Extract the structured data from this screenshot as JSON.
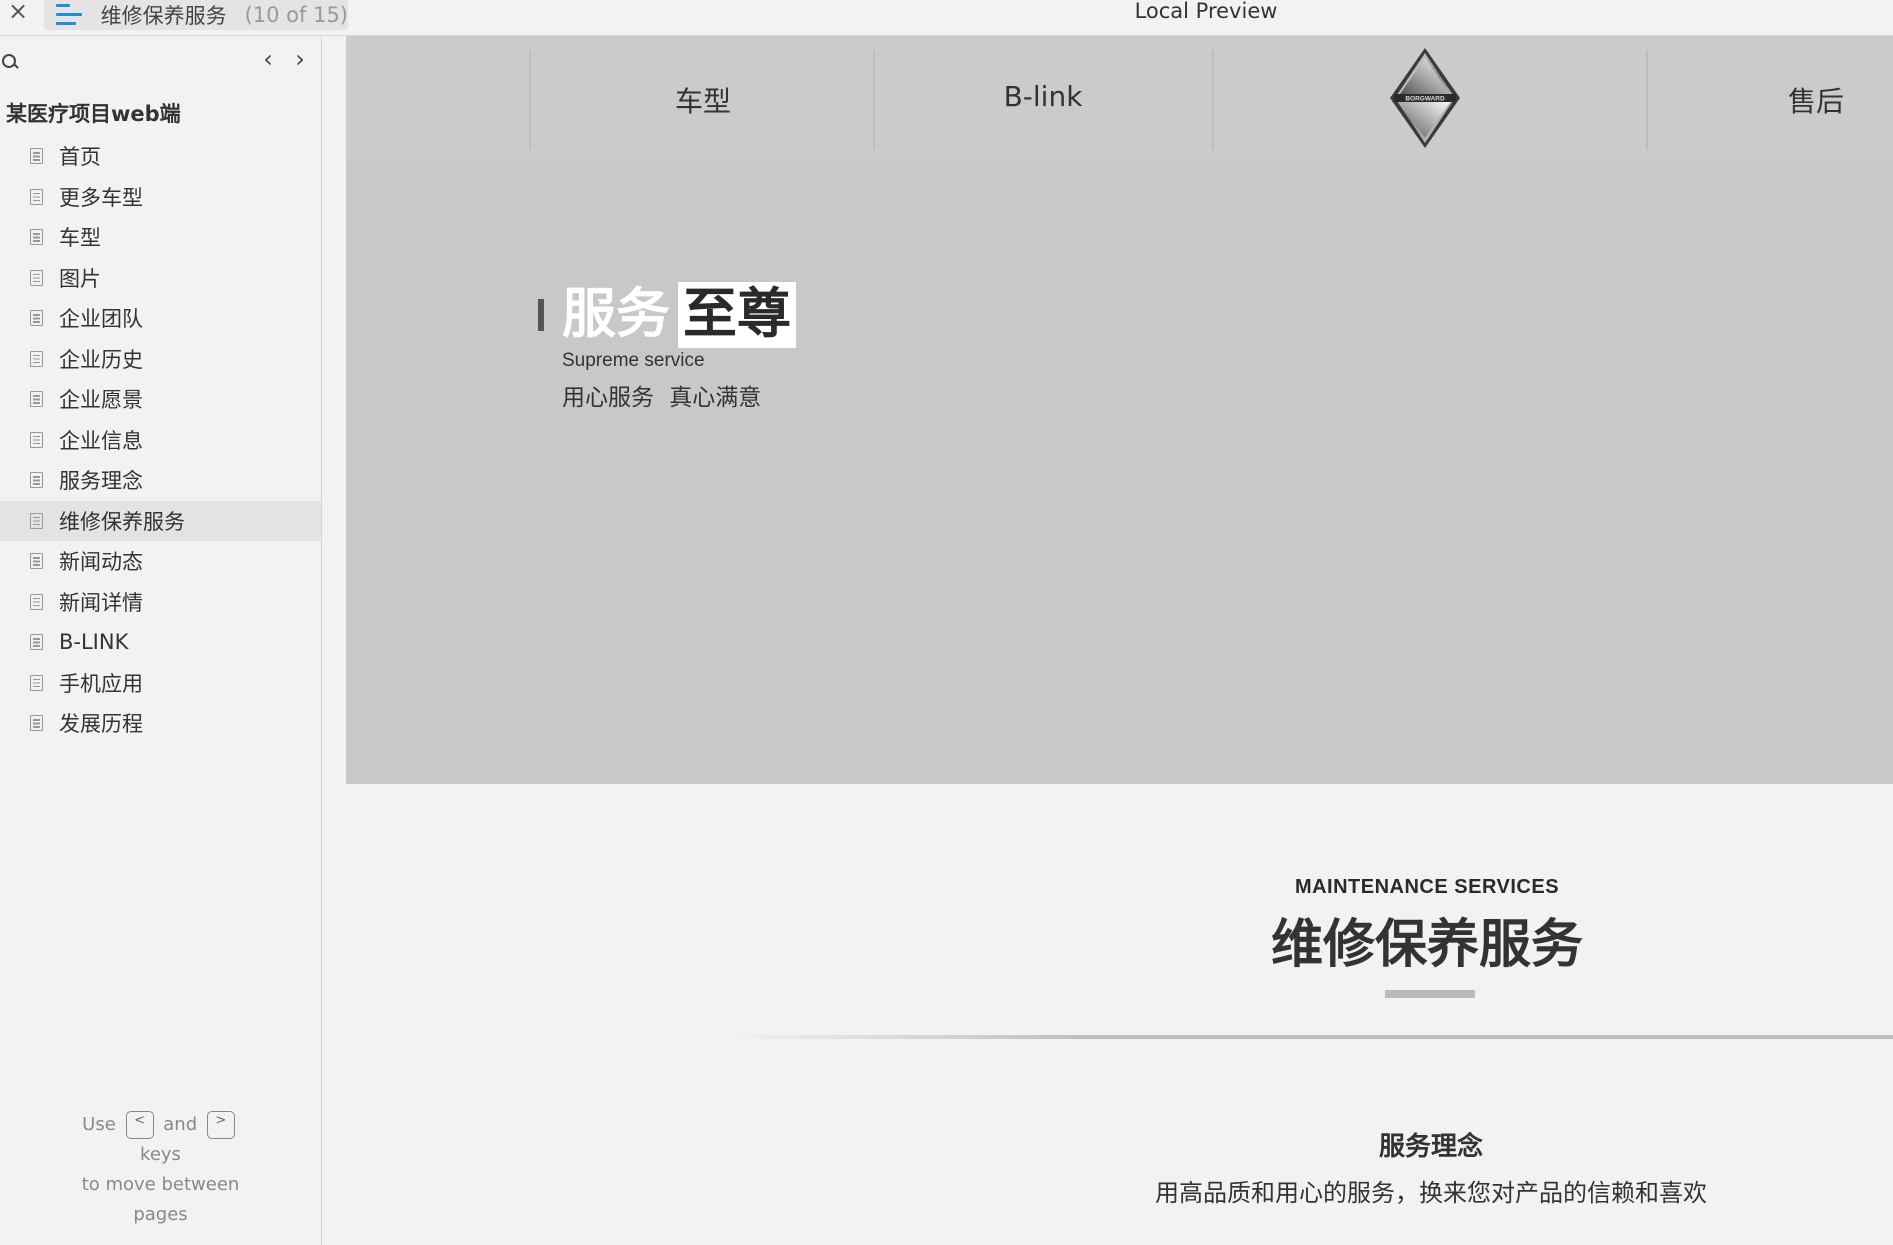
{
  "window": {
    "close_glyph": "×",
    "tab_title": "维修保养服务",
    "tab_count": "(10 of 15)",
    "title": "Local Preview"
  },
  "sidebar": {
    "project_name": "某医疗项目web端",
    "prev_glyph": "‹",
    "next_glyph": "›",
    "items": [
      {
        "label": "首页"
      },
      {
        "label": "更多车型"
      },
      {
        "label": "车型"
      },
      {
        "label": "图片"
      },
      {
        "label": "企业团队"
      },
      {
        "label": "企业历史"
      },
      {
        "label": "企业愿景"
      },
      {
        "label": "企业信息"
      },
      {
        "label": "服务理念"
      },
      {
        "label": "维修保养服务",
        "active": true
      },
      {
        "label": "新闻动态"
      },
      {
        "label": "新闻详情"
      },
      {
        "label": "B-LINK"
      },
      {
        "label": "手机应用"
      },
      {
        "label": "发展历程"
      }
    ],
    "help": {
      "use": "Use",
      "key_prev": "<",
      "and": "and",
      "key_next": ">",
      "keys": "keys",
      "line2": "to move between",
      "line3": "pages"
    }
  },
  "preview": {
    "nav": {
      "item1": "车型",
      "item2": "B-link",
      "logo_text": "BORGWARD",
      "item3": "售后"
    },
    "hero": {
      "title_white": "服务",
      "title_boxed": "至尊",
      "subtitle_en": "Supreme service",
      "subtitle_cn": "用心服务 真心满意"
    },
    "section": {
      "title_en": "MAINTENANCE SERVICES",
      "title_cn": "维修保养服务",
      "concept_title": "服务理念",
      "concept_text": "用高品质和用心的服务，换来您对产品的信赖和喜欢"
    }
  }
}
